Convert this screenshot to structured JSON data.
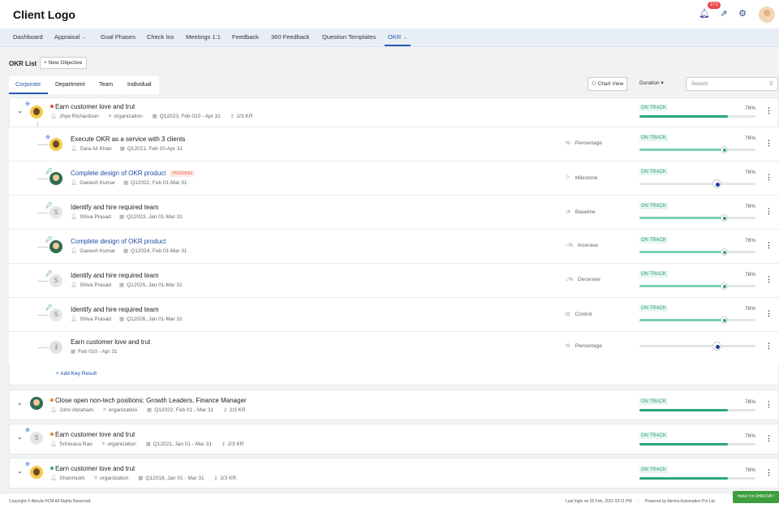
{
  "header": {
    "logo": "Client Logo",
    "notification_count": "271"
  },
  "nav": {
    "items": [
      "Dashboard",
      "Appraisal",
      "Goal Phases",
      "Check Ins",
      "Meetings 1:1",
      "Feedback",
      "360 Feedback",
      "Question Templates",
      "OKR"
    ]
  },
  "toolbar": {
    "okr_list": "OKR List",
    "new_objective": "+ New Objective",
    "chart_view": "Chart View",
    "duration": "Duration",
    "search_placeholder": "Search"
  },
  "tabs": [
    "Corporate",
    "Department",
    "Team",
    "Individual"
  ],
  "objectives": [
    {
      "title": "Earn customer love and trut",
      "owner": "Jhye Richardson",
      "scope": "organization",
      "period": "Q12023, Feb 010 - Apr 31",
      "kr": "2/3 KR",
      "status": "ON TRACK",
      "progress": "76%"
    },
    {
      "title": "Close open non-tech positions: Growth Leaders, Finance Manager",
      "owner": "John Abraham",
      "scope": "organization",
      "period": "Q12022, Feb 01 - Mar 31",
      "kr": "2/3 KR",
      "status": "ON TRACK",
      "progress": "76%"
    },
    {
      "title": "Earn customer love and trut",
      "owner": "Srinivasa Rao",
      "scope": "organization",
      "period": "Q12021, Jan 01 - Mar 31",
      "kr": "2/3 KR",
      "status": "ON TRACK",
      "progress": "76%"
    },
    {
      "title": "Earn customer love and trut",
      "owner": "Shanmukh",
      "scope": "organization",
      "period": "Q12018, Jan 01 - Mar 31",
      "kr": "2/3 KR",
      "status": "ON TRACK",
      "progress": "76%"
    }
  ],
  "key_results": [
    {
      "title": "Execute OKR as a service with 3 clients",
      "owner": "Sara Ali Khan",
      "period": "Q12021, Feb 10-Apr 31",
      "type": "Percentage",
      "status": "ON TRACK",
      "progress": "76%"
    },
    {
      "title": "Complete design of OKR product",
      "pending": "PENDING",
      "owner": "Ganesh Kumar",
      "period": "Q12022, Feb 01-Mar 31",
      "type": "Milestone",
      "status": "ON TRACK",
      "progress": "76%"
    },
    {
      "title": "Identify and hire required team",
      "owner": "Shiva Prasad",
      "period": "Q12023, Jan 01-Mar 31",
      "type": "Baseline",
      "status": "ON TRACK",
      "progress": "76%"
    },
    {
      "title": "Complete design of OKR product",
      "owner": "Ganesh Kumar",
      "period": "Q12024, Feb 01-Mar 31",
      "type": "Incerase",
      "status": "ON TRACK",
      "progress": "76%"
    },
    {
      "title": "Identify and hire required team",
      "owner": "Shiva Prasad",
      "period": "Q12025, Jan 01-Mar 31",
      "type": "Decerase",
      "status": "ON TRACK",
      "progress": "76%"
    },
    {
      "title": "Identify and hire required team",
      "owner": "Shiva Prasad",
      "period": "Q12026, Jan 01-Mar 31",
      "type": "Control",
      "status": "ON TRACK",
      "progress": "76%"
    },
    {
      "title": "Earn customer love and trut",
      "period": "Feb 010 - Apr 31",
      "type": "Percentage"
    }
  ],
  "add_key_result": "+ Add Key Result",
  "footer": {
    "copyright": "Copyright © Akrivia HCM All Rights Reserved.",
    "last_login": "Last login on 26 Feb, 2021 03:11 PM",
    "powered": "Powered by Akrivia Automation Pvt Ltd."
  },
  "chat": "Hello! I'm DHRUVA !",
  "colors": {
    "accent": "#2a58b5",
    "on_track": "#2aa779",
    "pending": "#e46b4a"
  }
}
